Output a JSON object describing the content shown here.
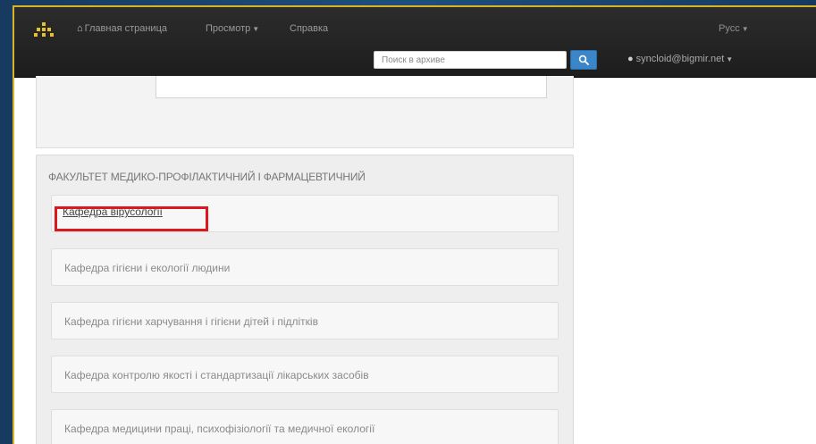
{
  "navbar": {
    "home_label": "Главная страница",
    "browse_label": "Просмотр",
    "help_label": "Справка",
    "language_label": "Русс",
    "search_placeholder": "Поиск в архиве",
    "user_email": "syncloid@bigmir.net"
  },
  "faculty": {
    "title": "ФАКУЛЬТЕТ МЕДИКО-ПРОФІЛАКТИЧНИЙ І ФАРМАЦЕВТИЧНИЙ",
    "departments": [
      "Кафедра вірусології",
      "Кафедра гігієни і екології людини",
      "Кафедра гігієни харчування і гігієни дітей і підлітків",
      "Кафедра контролю якості і стандартизації лікарських засобів",
      "Кафедра медицини праці, психофізіології та медичної екології"
    ]
  },
  "colors": {
    "navbar": "#222222",
    "search_button": "#3a86c8",
    "highlight": "#d9191f",
    "frame_border": "#d8b326"
  }
}
